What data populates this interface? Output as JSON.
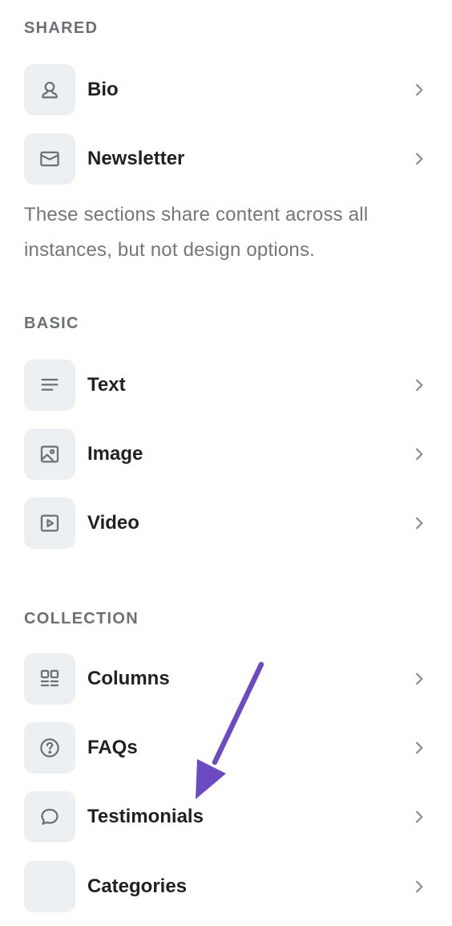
{
  "sections": {
    "shared": {
      "title": "SHARED",
      "items": [
        {
          "label": "Bio",
          "icon": "user-icon"
        },
        {
          "label": "Newsletter",
          "icon": "mail-icon"
        }
      ],
      "note": "These sections share content across all instances, but not design options."
    },
    "basic": {
      "title": "BASIC",
      "items": [
        {
          "label": "Text",
          "icon": "text-lines-icon"
        },
        {
          "label": "Image",
          "icon": "image-icon"
        },
        {
          "label": "Video",
          "icon": "video-icon"
        }
      ]
    },
    "collection": {
      "title": "COLLECTION",
      "items": [
        {
          "label": "Columns",
          "icon": "columns-icon"
        },
        {
          "label": "FAQs",
          "icon": "question-circle-icon"
        },
        {
          "label": "Testimonials",
          "icon": "speech-bubble-icon"
        },
        {
          "label": "Categories",
          "icon": ""
        }
      ]
    }
  },
  "colors": {
    "section_title": "#6b7075",
    "icon_bg": "#edf0f3",
    "icon_stroke": "#6b7075",
    "label": "#1e2226",
    "note": "#72777c",
    "chevron": "#8a8f94",
    "annotation_arrow": "#6c4bc2"
  }
}
